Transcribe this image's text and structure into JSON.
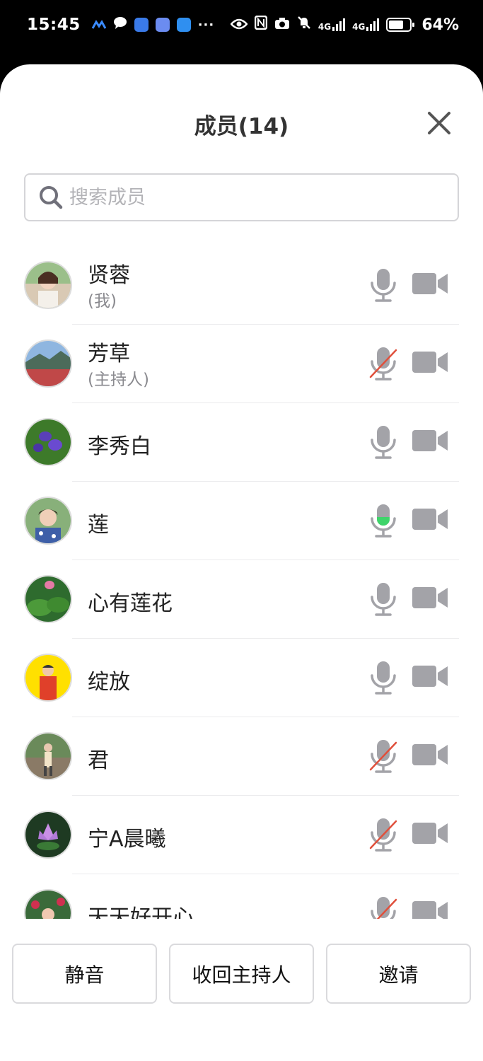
{
  "status_bar": {
    "time": "15:45",
    "battery": "64%",
    "overflow": "···",
    "network_1": "4G",
    "network_2": "4G"
  },
  "header": {
    "title": "成员(14)"
  },
  "search": {
    "placeholder": "搜索成员"
  },
  "members": [
    {
      "name": "贤蓉",
      "tag": "(我)",
      "mic": "on"
    },
    {
      "name": "芳草",
      "tag": "(主持人)",
      "mic": "muted"
    },
    {
      "name": "李秀白",
      "tag": "",
      "mic": "on"
    },
    {
      "name": "莲",
      "tag": "",
      "mic": "speaking"
    },
    {
      "name": "心有莲花",
      "tag": "",
      "mic": "on"
    },
    {
      "name": "绽放",
      "tag": "",
      "mic": "on"
    },
    {
      "name": "君",
      "tag": "",
      "mic": "muted"
    },
    {
      "name": "宁A晨曦",
      "tag": "",
      "mic": "muted"
    },
    {
      "name": "天天好开心",
      "tag": "",
      "mic": "muted"
    }
  ],
  "footer": {
    "mute_all": "静音",
    "reclaim_host": "收回主持人",
    "invite": "邀请"
  },
  "colors": {
    "icon_gray": "#a3a3a8",
    "muted_slash": "#e0503c",
    "speaking_green": "#3ed46a"
  }
}
